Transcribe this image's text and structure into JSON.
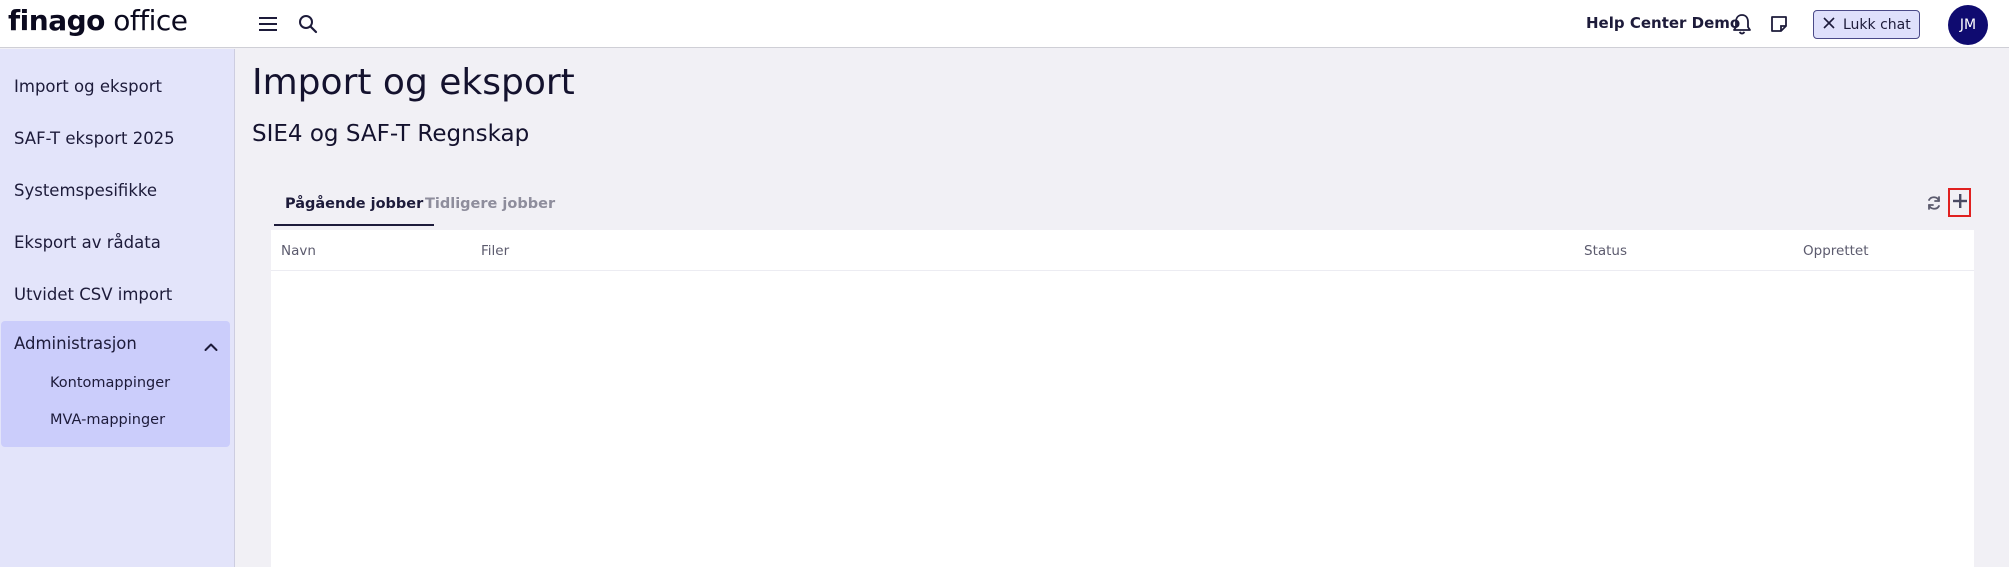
{
  "app": {
    "logo_bold": "finago",
    "logo_rest": " office"
  },
  "topbar": {
    "help_center": "Help Center Demo",
    "lukk_chat": "Lukk chat",
    "avatar_initials": "JM",
    "icons": [
      "menu-icon",
      "search-icon",
      "bell-icon",
      "note-icon",
      "close-icon"
    ]
  },
  "sidebar": {
    "items": [
      {
        "label": "Import og eksport"
      },
      {
        "label": "SAF-T eksport 2025"
      },
      {
        "label": "Systemspesifikke"
      },
      {
        "label": "Eksport av rådata"
      },
      {
        "label": "Utvidet CSV import"
      }
    ],
    "admin": {
      "label": "Administrasjon",
      "expanded": true,
      "children": [
        {
          "label": "Kontomappinger"
        },
        {
          "label": "MVA-mappinger"
        }
      ]
    }
  },
  "main": {
    "title": "Import og eksport",
    "subtitle": "SIE4 og SAF-T Regnskap",
    "tabs": [
      {
        "label": "Pågående jobber",
        "active": true
      },
      {
        "label": "Tidligere jobber",
        "active": false
      }
    ],
    "table": {
      "columns": [
        "Navn",
        "Filer",
        "Status",
        "Opprettet"
      ],
      "rows": []
    }
  },
  "colors": {
    "accent": "#0f0b70",
    "sidebar_bg": "#e3e4fa",
    "active_group_bg": "#cbcdfb",
    "highlight_border": "#e02020"
  }
}
